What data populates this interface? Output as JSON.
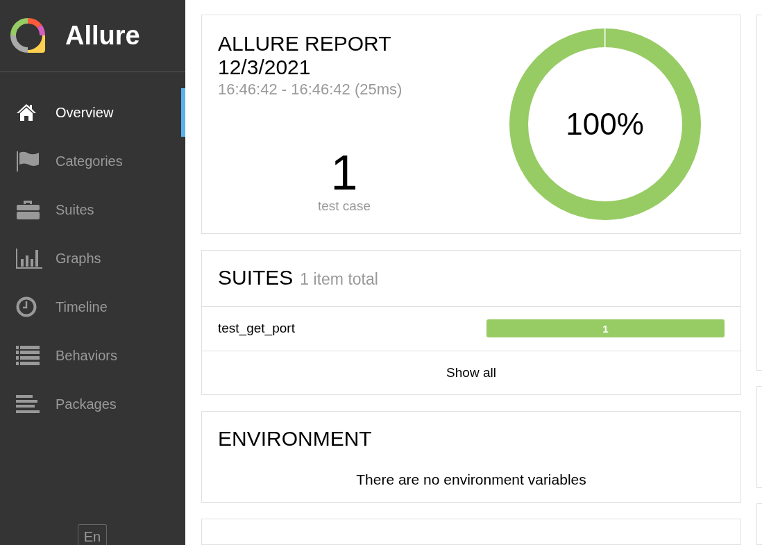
{
  "sidebar": {
    "brand": "Allure",
    "items": [
      {
        "label": "Overview",
        "selected": true
      },
      {
        "label": "Categories",
        "selected": false
      },
      {
        "label": "Suites",
        "selected": false
      },
      {
        "label": "Graphs",
        "selected": false
      },
      {
        "label": "Timeline",
        "selected": false
      },
      {
        "label": "Behaviors",
        "selected": false
      },
      {
        "label": "Packages",
        "selected": false
      }
    ],
    "language": "En"
  },
  "summary": {
    "title": "ALLURE REPORT",
    "date": "12/3/2021",
    "time_range": "16:46:42 - 16:46:42 (25ms)",
    "count": "1",
    "count_label": "test case",
    "donut_label": "100%"
  },
  "suites": {
    "title": "SUITES",
    "subtitle": "1 item total",
    "rows": [
      {
        "name": "test_get_port",
        "passed": "1",
        "level": 1
      }
    ],
    "show_all": "Show all"
  },
  "environment": {
    "title": "ENVIRONMENT",
    "message": "There are no environment variables"
  }
}
